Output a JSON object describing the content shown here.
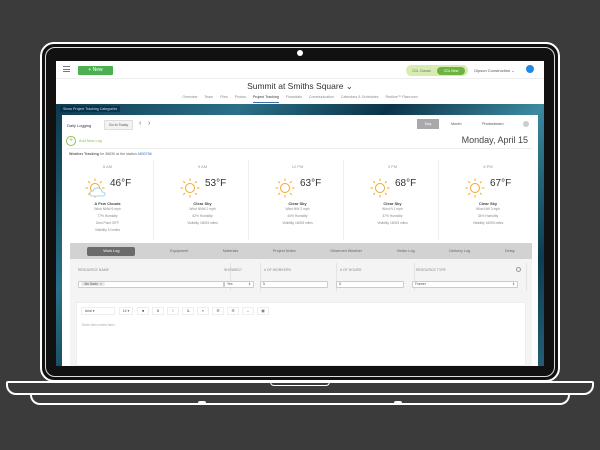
{
  "topbar": {
    "new_label": "+ New",
    "classic_label": "CDL Classic",
    "new_mode_label": "CDL New",
    "company": "Gipson Construction ⌄"
  },
  "project": {
    "title": "Summit at Smiths Square ⌄"
  },
  "tabs": [
    {
      "label": "Overview"
    },
    {
      "label": "Team"
    },
    {
      "label": "Files"
    },
    {
      "label": "Photos"
    },
    {
      "label": "Project Tracking",
      "active": true
    },
    {
      "label": "Financials"
    },
    {
      "label": "Communication"
    },
    {
      "label": "Calendars & Schedules"
    },
    {
      "label": "Redline™ Planroom"
    }
  ],
  "banner": {
    "categories_label": "Show Project Tracking Categories"
  },
  "daily": {
    "label": "Daily Logging",
    "today_label": "Go to Today",
    "views": [
      "Day",
      "Month",
      "Photostream"
    ],
    "add_label": "Add New Log",
    "date": "Monday, April 15"
  },
  "weather": {
    "label": "Weather Tracking",
    "suffix": "for 36830 at the station",
    "station": "4830796",
    "slots": [
      {
        "time": "6 AM",
        "temp": "46°F",
        "icon": "partly-cloudy",
        "cond": "A Few Clouds",
        "details": [
          "Wind NNW 6 mph",
          "77% Humidity",
          "Dew Point 39°F",
          "Visibility 10 miles"
        ]
      },
      {
        "time": "9 AM",
        "temp": "53°F",
        "icon": "sun",
        "cond": "Clear Sky",
        "details": [
          "Wind NNW 2 mph",
          "62% Humidity",
          "Visibility 16093 miles"
        ]
      },
      {
        "time": "12 PM",
        "temp": "63°F",
        "icon": "sun",
        "cond": "Clear Sky",
        "details": [
          "Wind NW 2 mph",
          "44% Humidity",
          "Visibility 16093 miles"
        ]
      },
      {
        "time": "3 PM",
        "temp": "68°F",
        "icon": "sun",
        "cond": "Clear Sky",
        "details": [
          "Wind N 1 mph",
          "37% Humidity",
          "Visibility 16093 miles"
        ]
      },
      {
        "time": "6 PM",
        "temp": "67°F",
        "icon": "sun",
        "cond": "Clear Sky",
        "details": [
          "Wind NW 3 mph",
          "34% Humidity",
          "Visibility 16093 miles"
        ]
      }
    ]
  },
  "logtabs": [
    {
      "label": "Work Log",
      "active": true
    },
    {
      "label": "Equipment"
    },
    {
      "label": "Materials"
    },
    {
      "label": "Project Notes"
    },
    {
      "label": "Observed Weather"
    },
    {
      "label": "Visitor Log"
    },
    {
      "label": "Delivery Log"
    },
    {
      "label": "Delay"
    }
  ],
  "worklog": {
    "headers": [
      "RESOURCE NAME",
      "SHOWED?",
      "# OF WORKERS",
      "# OF HOURS",
      "RESOURCE TYPE"
    ],
    "row": {
      "resource": "Jim Davis",
      "showed": "Yes",
      "workers": "5",
      "hours": "8",
      "type": "Framer"
    }
  },
  "editor": {
    "font": "Arial",
    "size": "14",
    "placeholder": "Enter item notes here..."
  },
  "colors": {
    "accent": "#4caf50",
    "link": "#3a6ea5"
  }
}
